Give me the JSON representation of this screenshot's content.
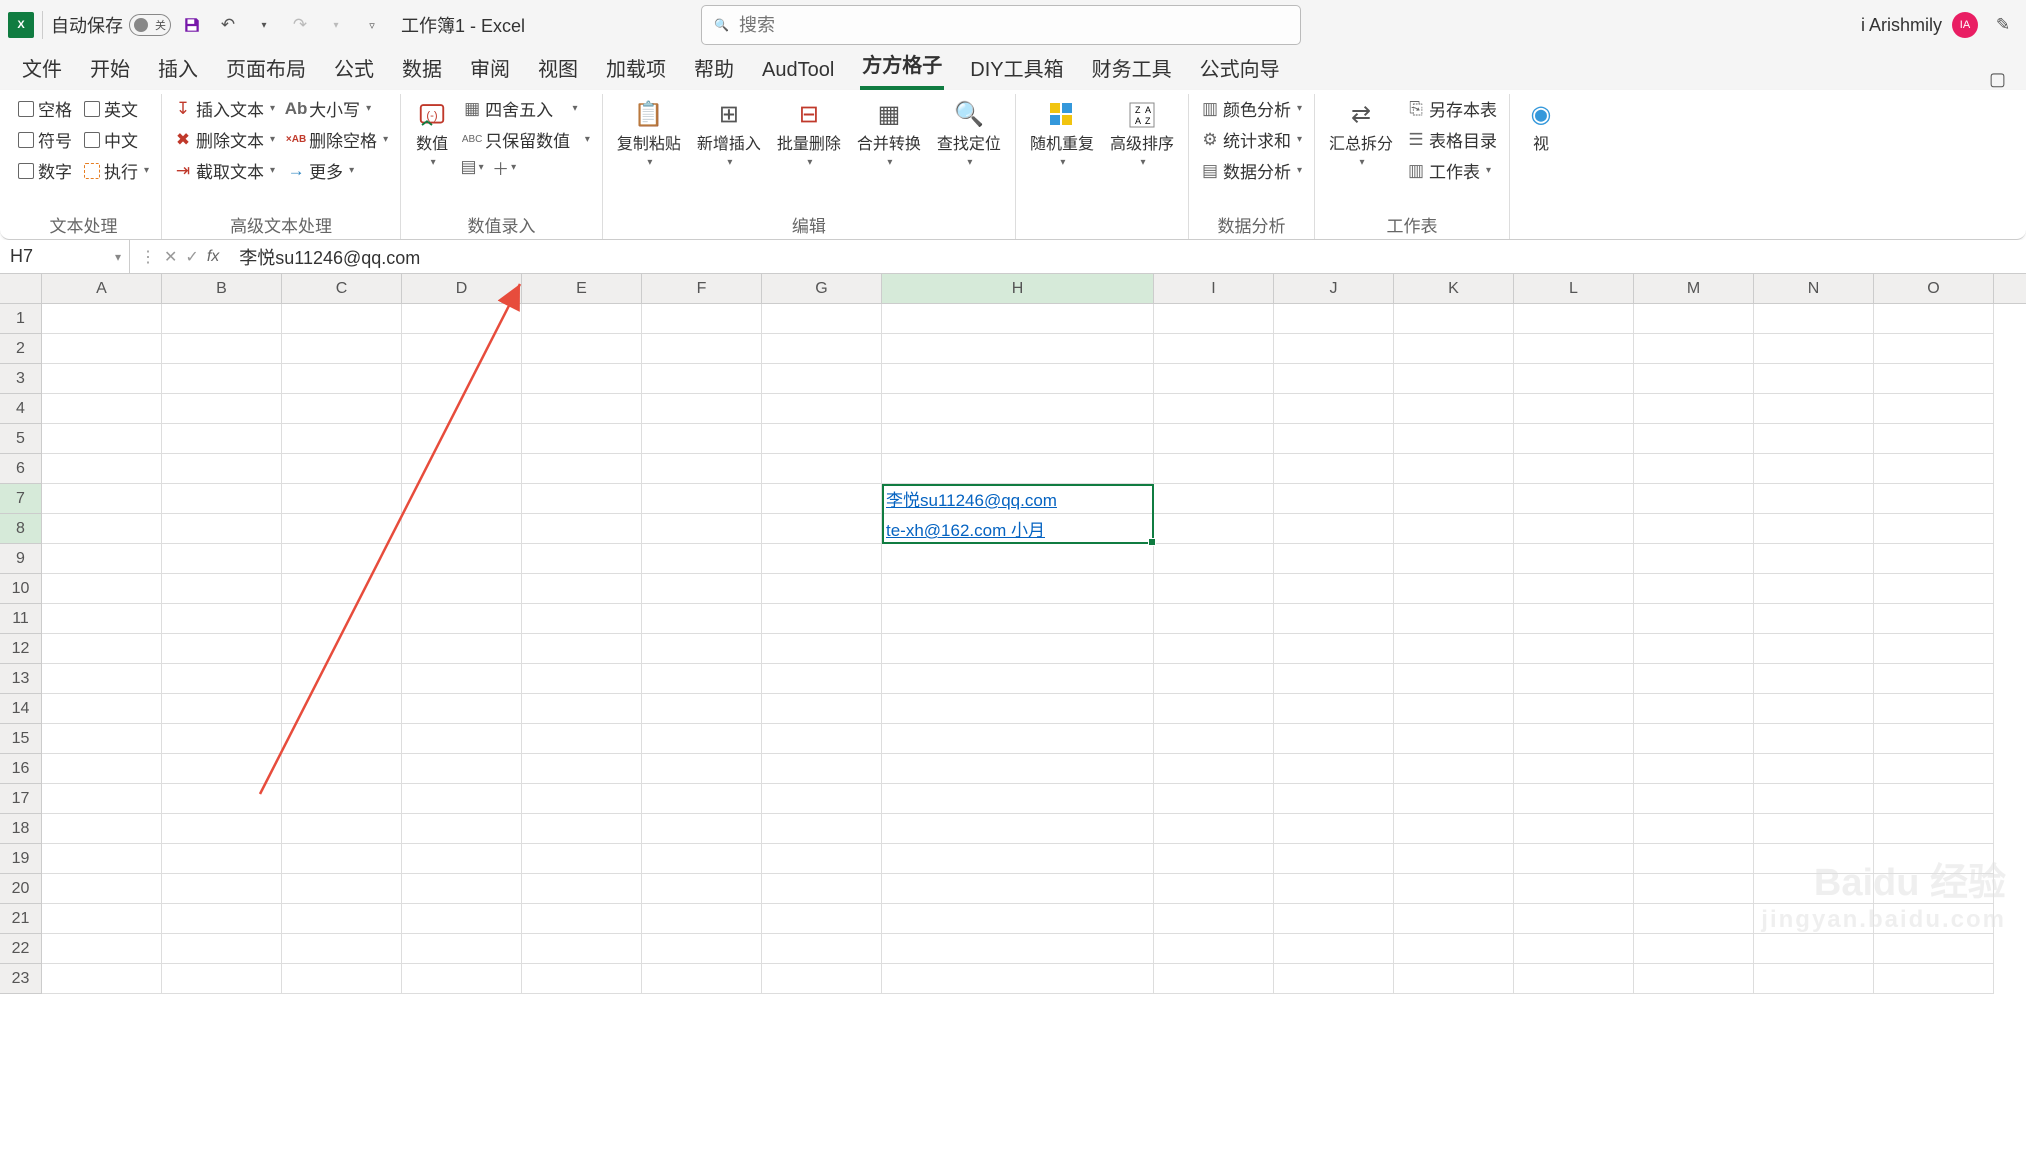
{
  "titlebar": {
    "autosave_label": "自动保存",
    "autosave_state": "关",
    "doc_title": "工作簿1 - Excel",
    "search_placeholder": "搜索",
    "user_name": "i Arishmily",
    "avatar_initials": "IA"
  },
  "tabs": [
    "文件",
    "开始",
    "插入",
    "页面布局",
    "公式",
    "数据",
    "审阅",
    "视图",
    "加载项",
    "帮助",
    "AudTool",
    "方方格子",
    "DIY工具箱",
    "财务工具",
    "公式向导"
  ],
  "active_tab": "方方格子",
  "ribbon": {
    "group_text": {
      "label": "文本处理",
      "items": [
        "空格",
        "英文",
        "符号",
        "中文",
        "数字",
        "执行"
      ]
    },
    "group_adv": {
      "label": "高级文本处理",
      "items": [
        "插入文本",
        "删除文本",
        "截取文本",
        "大小写",
        "删除空格",
        "更多"
      ]
    },
    "group_num": {
      "label": "数值录入",
      "big": "数值",
      "items": [
        "四舍五入",
        "只保留数值"
      ]
    },
    "group_edit": {
      "label": "编辑",
      "items": [
        "复制粘贴",
        "新增插入",
        "批量删除",
        "合并转换",
        "查找定位"
      ]
    },
    "group_sort": {
      "items": [
        "随机重复",
        "高级排序"
      ]
    },
    "group_ana": {
      "label": "数据分析",
      "items": [
        "颜色分析",
        "统计求和",
        "数据分析"
      ]
    },
    "group_sheet": {
      "label": "工作表",
      "big": "汇总拆分",
      "items": [
        "另存本表",
        "表格目录",
        "工作表"
      ]
    },
    "view": "视"
  },
  "fbar": {
    "cell": "H7",
    "formula": "李悦su11246@qq.com"
  },
  "cols": [
    "A",
    "B",
    "C",
    "D",
    "E",
    "F",
    "G",
    "H",
    "I",
    "J",
    "K",
    "L",
    "M",
    "N",
    "O"
  ],
  "row_count": 23,
  "cells": {
    "H7": "李悦su11246@qq.com",
    "H8": "te-xh@162.com 小月"
  },
  "selection": {
    "start": "H7",
    "end": "H8"
  },
  "watermark": {
    "main": "Baidu 经验",
    "sub": "jingyan.baidu.com"
  }
}
